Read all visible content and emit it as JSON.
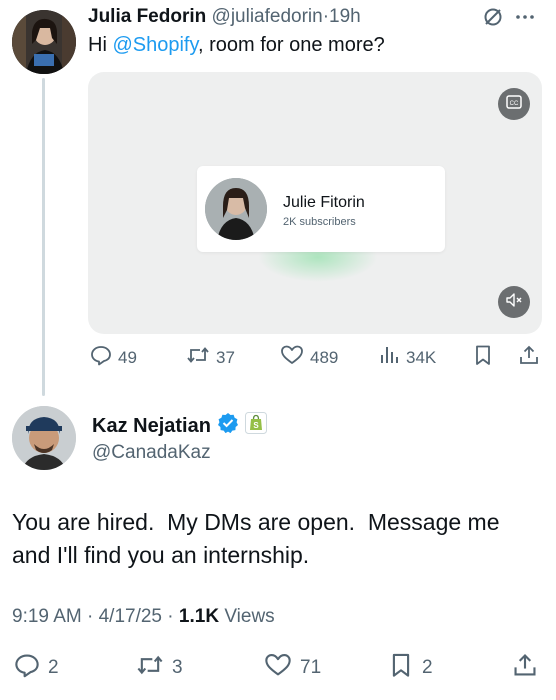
{
  "tweet1": {
    "author_name": "Julia Fedorin",
    "handle": "@juliafedorin",
    "separator": "·",
    "time": "19h",
    "text_prefix": "Hi ",
    "mention": "@Shopify",
    "text_suffix": ", room for one more?",
    "media": {
      "card_name": "Julie Fitorin",
      "card_subscribers": "2K subscribers",
      "cc_icon": "closed-captions-icon",
      "mute_icon": "volume-muted-icon"
    },
    "actions": {
      "replies": "49",
      "reposts": "37",
      "likes": "489",
      "views": "34K"
    }
  },
  "tweet2": {
    "author_name": "Kaz Nejatian",
    "handle": "@CanadaKaz",
    "text_line1": "You are hired.  My DMs are open.  Message me",
    "text_line2": "and I'll find you an internship.",
    "time": "9:19 AM",
    "date": "4/17/25",
    "views_count": "1.1K",
    "views_label": " Views",
    "sep": " · ",
    "actions": {
      "replies": "2",
      "reposts": "3",
      "likes": "71",
      "bookmarks": "2"
    }
  },
  "colors": {
    "link_blue": "#1d9bf0",
    "verified_blue": "#1d9bf0",
    "shopify_green": "#95bf47",
    "muted_gray": "#536471",
    "text": "#0f1419"
  }
}
